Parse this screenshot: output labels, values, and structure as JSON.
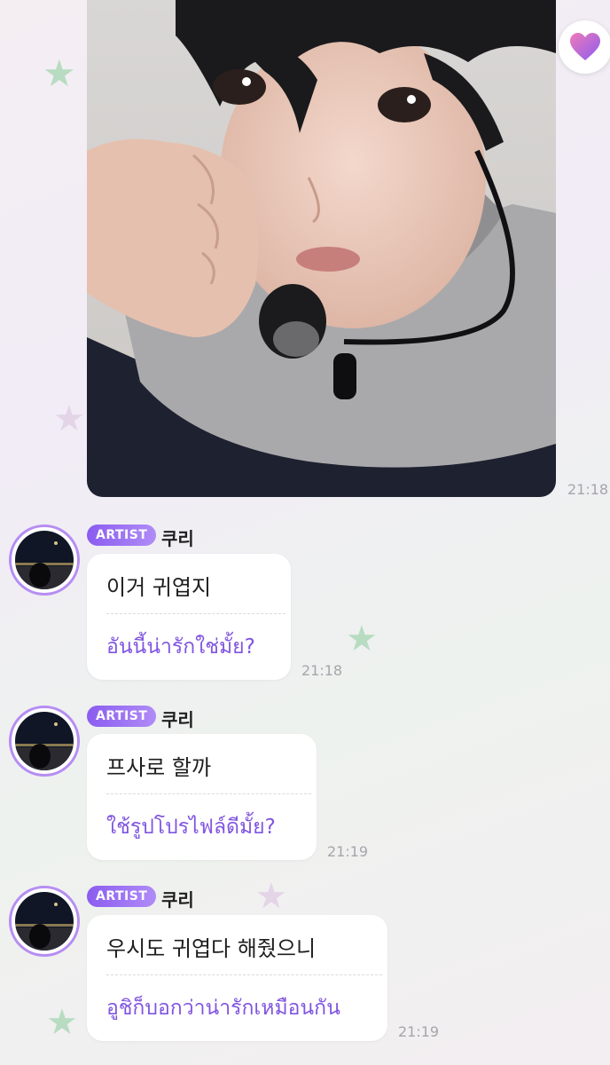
{
  "photo": {
    "timestamp": "21:18"
  },
  "reaction_icon": "heart-icon",
  "colors": {
    "accent": "#8a5cf0",
    "translation": "#8055e0",
    "avatar_ring": "#b68df3"
  },
  "messages": [
    {
      "badge": "ARTIST",
      "sender": "쿠리",
      "text": "이거 귀엽지",
      "translation": "อันนี้น่ารักใช่มั้ย?",
      "time": "21:18"
    },
    {
      "badge": "ARTIST",
      "sender": "쿠리",
      "text": "프사로 할까",
      "translation": "ใช้รูปโปรไฟล์ดีมั้ย?",
      "time": "21:19"
    },
    {
      "badge": "ARTIST",
      "sender": "쿠리",
      "text": "우시도 귀엽다 해줬으니",
      "translation": "อูชิก็บอกว่าน่ารักเหมือนกัน",
      "time": "21:19"
    }
  ]
}
